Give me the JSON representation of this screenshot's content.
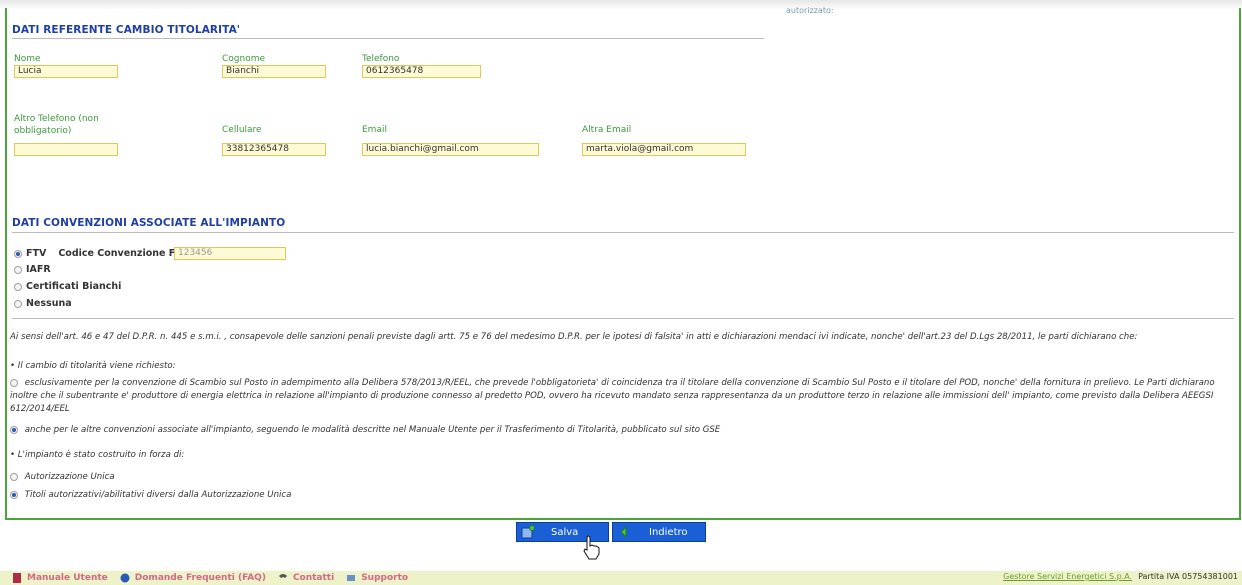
{
  "side_text": "autorizzato:",
  "referente": {
    "title": "DATI REFERENTE CAMBIO TITOLARITA'",
    "nome_label": "Nome",
    "nome_value": "Lucia",
    "cognome_label": "Cognome",
    "cognome_value": "Bianchi",
    "telefono_label": "Telefono",
    "telefono_value": "0612365478",
    "altro_tel_label_1": "Altro Telefono (non",
    "altro_tel_label_2": "obbligatorio)",
    "altro_tel_value": "",
    "cellulare_label": "Cellulare",
    "cellulare_value": "33812365478",
    "email_label": "Email",
    "email_value": "lucia.bianchi@gmail.com",
    "altra_email_label": "Altra Email",
    "altra_email_value": "marta.viola@gmail.com"
  },
  "convenzioni": {
    "title": "DATI CONVENZIONI ASSOCIATE ALL'IMPIANTO",
    "options": [
      {
        "label": "FTV",
        "checked": true
      },
      {
        "label": "IAFR",
        "checked": false
      },
      {
        "label": "Certificati Bianchi",
        "checked": false
      },
      {
        "label": "Nessuna",
        "checked": false
      }
    ],
    "codice_label": "Codice Convenzione FTV:",
    "codice_value": "123456"
  },
  "dichiarazione": {
    "intro": "Ai sensi dell'art. 46 e 47 del D.P.R. n. 445 e s.m.i. , consapevole delle sanzioni penali previste dagli artt. 75 e 76 del medesimo D.P.R. per le ipotesi di falsita' in atti e dichiarazioni mendaci ivi indicate, nonche' dell'art.23 del D.Lgs 28/2011, le parti dichiarano che:",
    "cambio_title": "• Il cambio di titolarità viene richiesto:",
    "cambio_opt1": "esclusivamente per la convenzione di Scambio sul Posto in adempimento alla Delibera 578/2013/R/EEL, che prevede l'obbligatorieta' di coincidenza tra il titolare della convenzione di Scambio Sul Posto e il titolare del POD, nonche' della fornitura in prelievo. Le Parti dichiarano inoltre che il subentrante e' produttore di energia elettrica in relazione all'impianto di produzione connesso al predetto POD, ovvero ha ricevuto mandato senza rappresentanza da un produttore terzo in relazione alle immissioni dell' impianto, come previsto dalla Delibera AEEGSI 612/2014/EEL",
    "cambio_opt2": "anche per le altre convenzioni associate all'impianto, seguendo le modalità descritte nel Manuale Utente per il Trasferimento di Titolarità, pubblicato sul sito GSE",
    "impianto_title": "• L'impianto è stato costruito in forza di:",
    "impianto_opt1": "Autorizzazione Unica",
    "impianto_opt2": "Titoli autorizzativi/abilitativi diversi dalla Autorizzazione Unica"
  },
  "buttons": {
    "salva": "Salva",
    "indietro": "Indietro"
  },
  "footer": {
    "manuale": "Manuale Utente",
    "faq": "Domande Frequenti (FAQ)",
    "contatti": "Contatti",
    "supporto": "Supporto",
    "company": "Gestore Servizi Energetici S.p.A.",
    "piva": "Partita IVA 05754381001"
  },
  "colors": {
    "section_title": "#1f3fa6",
    "label_green": "#3c9a3c",
    "button_blue": "#1a5fd6",
    "footer_bg": "#eef2c8"
  }
}
